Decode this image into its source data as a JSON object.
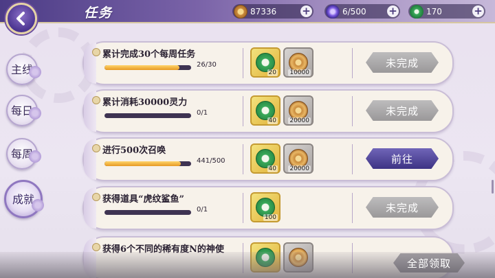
{
  "header": {
    "title": "任务",
    "back_icon": "back-arrow-icon",
    "resources": [
      {
        "name": "coin",
        "icon": "coin-icon",
        "value": "87336"
      },
      {
        "name": "stamina",
        "icon": "spirit-flame-icon",
        "value": "6/500"
      },
      {
        "name": "jade",
        "icon": "jade-icon",
        "value": "170"
      }
    ],
    "plus_label": "+"
  },
  "sidebar": {
    "tabs": [
      {
        "label": "主线",
        "active": false
      },
      {
        "label": "每日",
        "active": false
      },
      {
        "label": "每周",
        "active": false
      },
      {
        "label": "成就",
        "active": true
      }
    ]
  },
  "tasks": [
    {
      "name": "累计完成30个每周任务",
      "progress_text": "26/30",
      "progress": 0.867,
      "rewards": [
        {
          "type": "jade",
          "qty": "20"
        },
        {
          "type": "coin",
          "qty": "10000"
        }
      ],
      "status": "未完成",
      "status_kind": "incomplete"
    },
    {
      "name": "累计消耗30000灵力",
      "progress_text": "0/1",
      "progress": 0.0,
      "rewards": [
        {
          "type": "jade",
          "qty": "40"
        },
        {
          "type": "coin",
          "qty": "20000"
        }
      ],
      "status": "未完成",
      "status_kind": "incomplete"
    },
    {
      "name": "进行500次召唤",
      "progress_text": "441/500",
      "progress": 0.882,
      "rewards": [
        {
          "type": "jade",
          "qty": "40"
        },
        {
          "type": "coin",
          "qty": "20000"
        }
      ],
      "status": "前往",
      "status_kind": "goto"
    },
    {
      "name": "获得道具“虎纹鲨鱼”",
      "progress_text": "0/1",
      "progress": 0.0,
      "rewards": [
        {
          "type": "jade",
          "qty": "100"
        }
      ],
      "status": "未完成",
      "status_kind": "incomplete"
    },
    {
      "name": "获得6个不同的稀有度N的神使",
      "progress_text": "",
      "progress": 0.0,
      "rewards": [
        {
          "type": "jade",
          "qty": ""
        },
        {
          "type": "coin",
          "qty": ""
        }
      ],
      "status": "",
      "status_kind": "hidden"
    }
  ],
  "footer": {
    "claim_all": "全部领取"
  },
  "colors": {
    "accent_purple": "#4c3c86",
    "progress_fill": "#e69a23",
    "goto_button": "#3d3384"
  }
}
